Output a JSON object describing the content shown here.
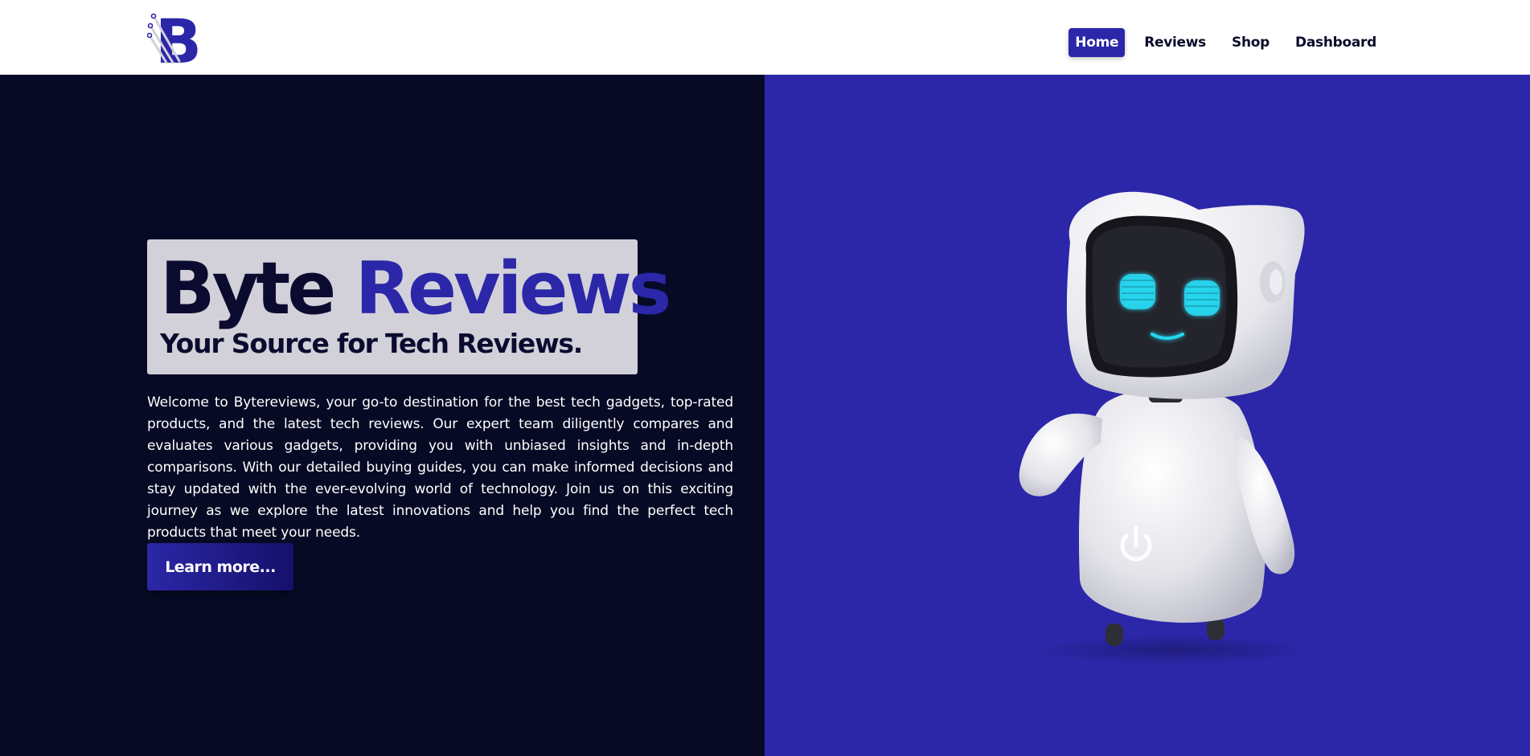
{
  "header": {
    "logo_letter": "B",
    "nav": [
      {
        "label": "Home",
        "active": true
      },
      {
        "label": "Reviews",
        "active": false
      },
      {
        "label": "Shop",
        "active": false
      },
      {
        "label": "Dashboard",
        "active": false
      }
    ]
  },
  "hero": {
    "title_word1": "Byte",
    "title_word2": "Reviews",
    "subtitle": "Your Source for Tech Reviews.",
    "intro": "Welcome to Bytereviews, your go-to destination for the best tech gadgets, top-rated products, and the latest tech reviews. Our expert team diligently compares and evaluates various gadgets, providing you with unbiased insights and in-depth comparisons. With our detailed buying guides, you can make informed decisions and stay updated with the ever-evolving world of technology. Join us on this exciting journey as we explore the latest innovations and help you find the perfect tech products that meet your needs.",
    "cta_label": "Learn more..."
  },
  "colors": {
    "brand": "#2b27a8",
    "dark": "#070a24",
    "title_box": "#d2d1da",
    "eye_glow": "#27d6ee"
  },
  "icons": [
    "logo-icon",
    "robot-illustration",
    "power-icon"
  ]
}
